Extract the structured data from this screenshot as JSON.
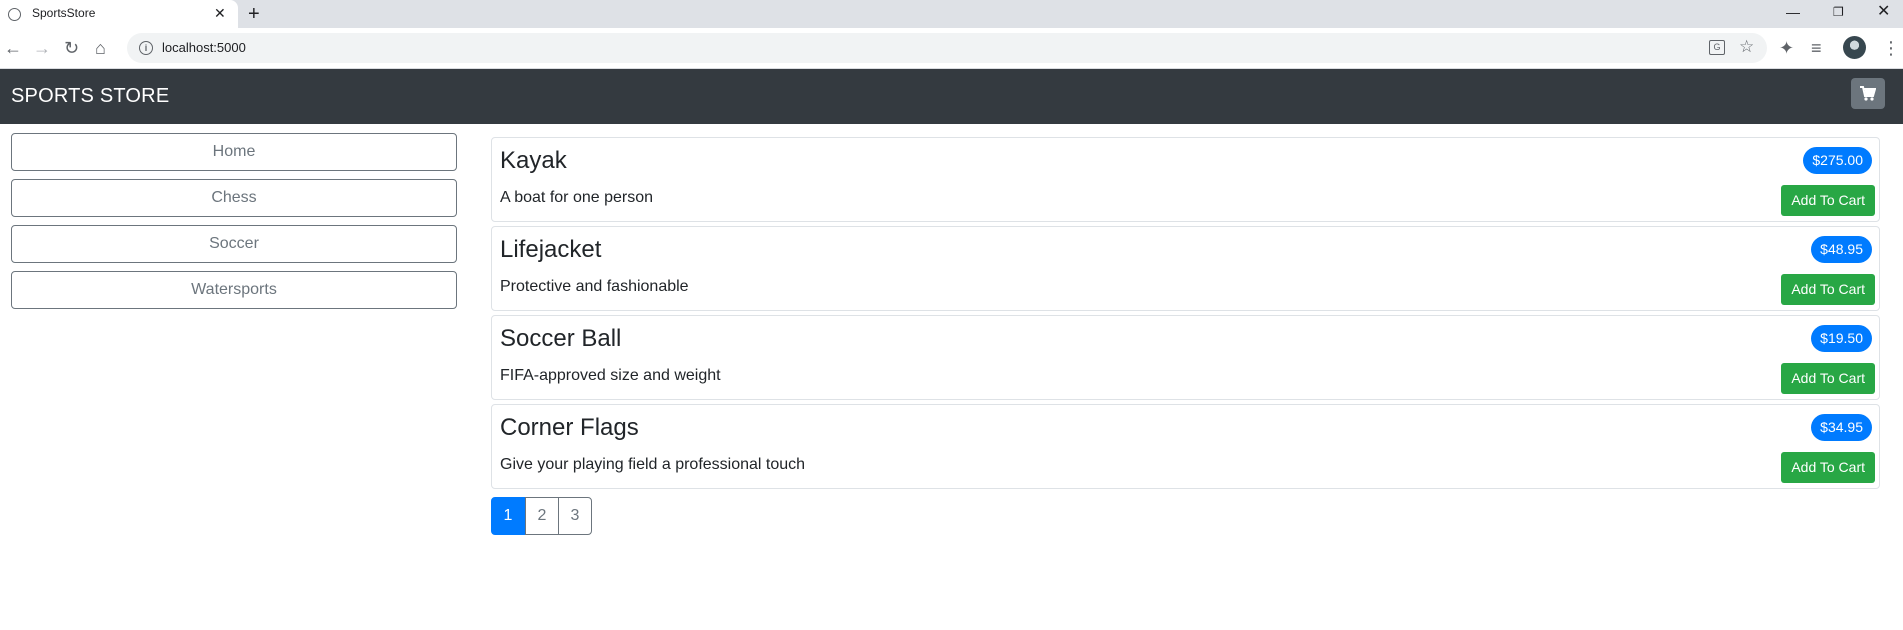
{
  "browser": {
    "tab_title": "SportsStore",
    "tab_close": "✕",
    "new_tab": "+",
    "url": "localhost:5000",
    "icons": [
      "back-icon",
      "forward-icon",
      "reload-icon",
      "home-icon",
      "info-icon",
      "translate-icon",
      "star-icon",
      "extensions-icon",
      "reading-list-icon",
      "profile-avatar",
      "menu-icon"
    ]
  },
  "navbar": {
    "brand": "SPORTS STORE",
    "cart_icon": "cart-icon"
  },
  "sidebar": {
    "categories": [
      {
        "label": "Home"
      },
      {
        "label": "Chess"
      },
      {
        "label": "Soccer"
      },
      {
        "label": "Watersports"
      }
    ]
  },
  "products": [
    {
      "name": "Kayak",
      "description": "A boat for one person",
      "price": "$275.00",
      "button": "Add To Cart"
    },
    {
      "name": "Lifejacket",
      "description": "Protective and fashionable",
      "price": "$48.95",
      "button": "Add To Cart"
    },
    {
      "name": "Soccer Ball",
      "description": "FIFA-approved size and weight",
      "price": "$19.50",
      "button": "Add To Cart"
    },
    {
      "name": "Corner Flags",
      "description": "Give your playing field a professional touch",
      "price": "$34.95",
      "button": "Add To Cart"
    }
  ],
  "pagination": {
    "pages": [
      "1",
      "2",
      "3"
    ],
    "current": "1"
  },
  "colors": {
    "navbar": "#343a40",
    "primary": "#007bff",
    "success": "#28a745",
    "secondary": "#6c757d"
  }
}
